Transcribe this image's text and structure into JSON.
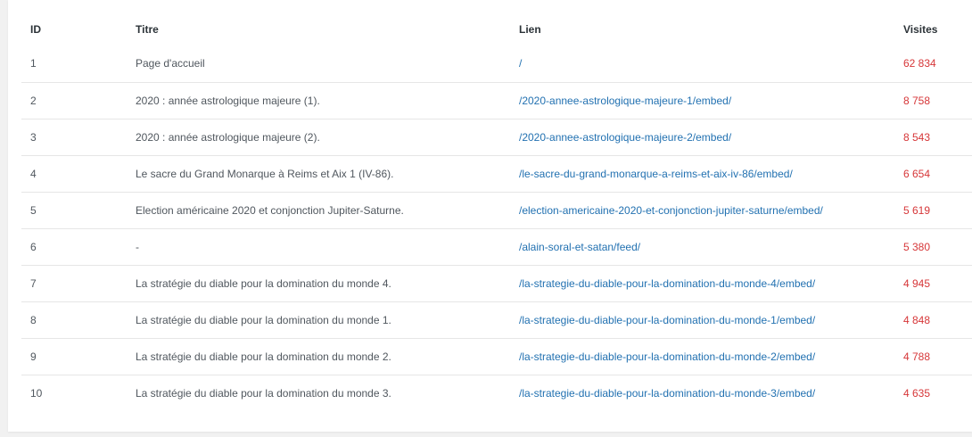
{
  "table": {
    "headers": {
      "id": "ID",
      "title": "Titre",
      "link": "Lien",
      "visits": "Visites"
    },
    "rows": [
      {
        "id": "1",
        "title": "Page d'accueil",
        "link": "/",
        "visits": "62 834"
      },
      {
        "id": "2",
        "title": "2020 : année astrologique majeure (1).",
        "link": "/2020-annee-astrologique-majeure-1/embed/",
        "visits": "8 758"
      },
      {
        "id": "3",
        "title": "2020 : année astrologique majeure (2).",
        "link": "/2020-annee-astrologique-majeure-2/embed/",
        "visits": "8 543"
      },
      {
        "id": "4",
        "title": "Le sacre du Grand Monarque à Reims et Aix 1 (IV-86).",
        "link": "/le-sacre-du-grand-monarque-a-reims-et-aix-iv-86/embed/",
        "visits": "6 654"
      },
      {
        "id": "5",
        "title": "Election américaine 2020 et conjonction Jupiter-Saturne.",
        "link": "/election-americaine-2020-et-conjonction-jupiter-saturne/embed/",
        "visits": "5 619"
      },
      {
        "id": "6",
        "title": "-",
        "link": "/alain-soral-et-satan/feed/",
        "visits": "5 380"
      },
      {
        "id": "7",
        "title": "La stratégie du diable pour la domination du monde 4.",
        "link": "/la-strategie-du-diable-pour-la-domination-du-monde-4/embed/",
        "visits": "4 945"
      },
      {
        "id": "8",
        "title": "La stratégie du diable pour la domination du monde 1.",
        "link": "/la-strategie-du-diable-pour-la-domination-du-monde-1/embed/",
        "visits": "4 848"
      },
      {
        "id": "9",
        "title": "La stratégie du diable pour la domination du monde 2.",
        "link": "/la-strategie-du-diable-pour-la-domination-du-monde-2/embed/",
        "visits": "4 788"
      },
      {
        "id": "10",
        "title": "La stratégie du diable pour la domination du monde 3.",
        "link": "/la-strategie-du-diable-pour-la-domination-du-monde-3/embed/",
        "visits": "4 635"
      }
    ]
  },
  "colors": {
    "link": "#2271b1",
    "visits": "#d63638",
    "text": "#50575e",
    "header": "#2c3338"
  }
}
